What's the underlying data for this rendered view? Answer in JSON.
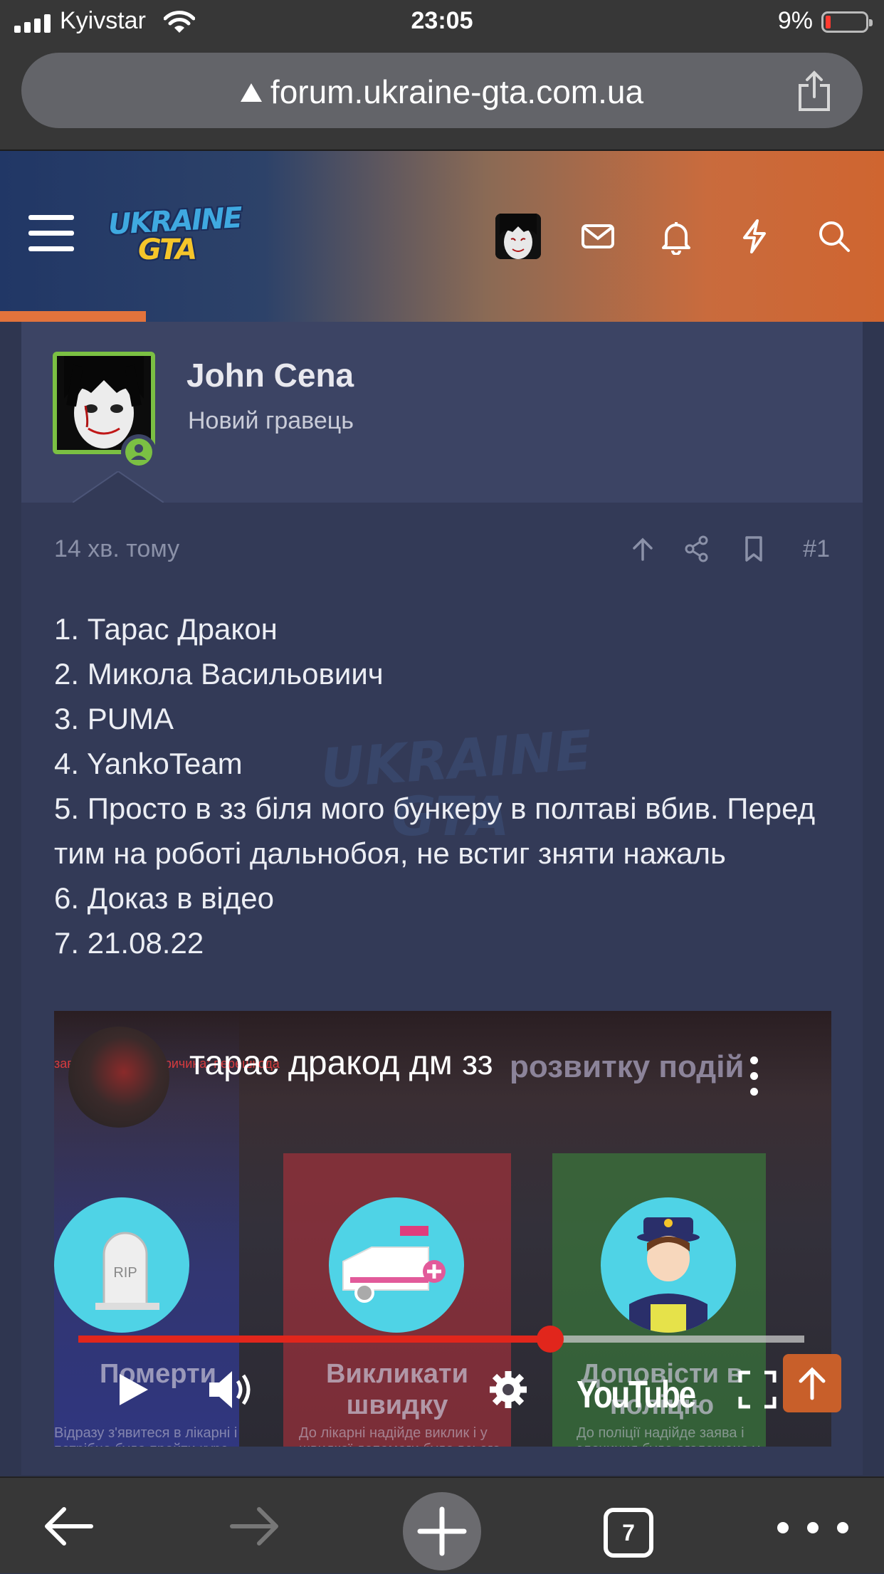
{
  "status_bar": {
    "carrier": "Kyivstar",
    "time": "23:05",
    "battery": "9%"
  },
  "browser": {
    "url": "forum.ukraine-gta.com.ua",
    "tab_count": "7"
  },
  "forum_header": {
    "logo_line1": "UKRAINE",
    "logo_line2": "GTA"
  },
  "post": {
    "author": "John Cena",
    "author_title": "Новий гравець",
    "time": "14 хв. тому",
    "number": "#1",
    "lines": [
      "1. Тарас Дракон",
      "2. Микола Васильовиич",
      "3. PUMA",
      "4. YankoTeam",
      "5. Просто в зз біля мого бункеру в полтаві вбив. Перед тим на роботі дальнобоя, не встиг зняти нажаль",
      "6. Доказ в відео",
      "7. 21.08.22"
    ]
  },
  "video": {
    "title": "тарас дракод дм зз",
    "bg_top_text": "розвитку подій",
    "bg_red_text": "зав         на 1 хвилин. Причина: перешкода",
    "panel1_label": "Померти",
    "panel2_label": "Викликати швидку",
    "panel3_label": "Доповісти в поліцію",
    "panel1_small": "Відразу з'явитеся в лікарні і потрібно буде пройти курс",
    "panel2_small": "До лікарні надійде виклик і у швидкої допомоги буде всього",
    "panel3_small": "До поліції надійде заява і злочинця буде оголошено у",
    "brand": "YouTube",
    "progress": 0.65
  },
  "colors": {
    "accent": "#c85f2a",
    "online": "#7bc043",
    "video_progress": "#e1261c"
  }
}
